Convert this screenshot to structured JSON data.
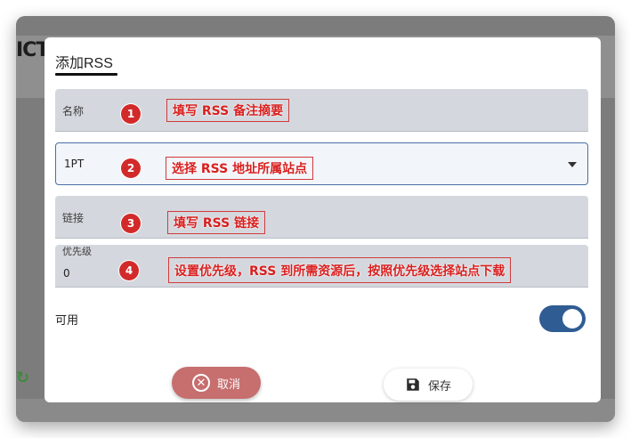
{
  "background": {
    "logo_text": "ICT"
  },
  "dialog": {
    "title": "添加RSS",
    "fields": {
      "name": {
        "label": "名称"
      },
      "site": {
        "value": "1PT"
      },
      "link": {
        "label": "链接"
      },
      "priority": {
        "label": "优先级",
        "value": "0"
      }
    },
    "enable_label": "可用",
    "enabled": true,
    "buttons": {
      "cancel": "取消",
      "save": "保存"
    }
  },
  "annotations": [
    {
      "number": "1",
      "text": "填写 RSS 备注摘要"
    },
    {
      "number": "2",
      "text": "选择 RSS 地址所属站点"
    },
    {
      "number": "3",
      "text": "填写 RSS 链接"
    },
    {
      "number": "4",
      "text": "设置优先级，RSS 到所需资源后，按照优先级选择站点下载"
    }
  ],
  "colors": {
    "accent": "#2f5c93",
    "cancel": "#c76e6e",
    "annotation": "#d22a2a",
    "field_bg": "#d4d8de"
  },
  "icons": {
    "cancel": "close-circle-icon",
    "save": "floppy-disk-icon",
    "select": "caret-down-icon",
    "refresh": "refresh-icon"
  }
}
